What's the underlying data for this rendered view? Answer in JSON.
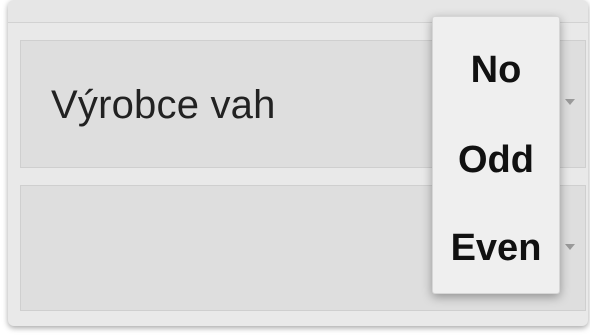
{
  "form": {
    "row_1_label": "Výrobce vah",
    "row_2_label": ""
  },
  "dropdown": {
    "options": [
      "No",
      "Odd",
      "Even"
    ]
  }
}
